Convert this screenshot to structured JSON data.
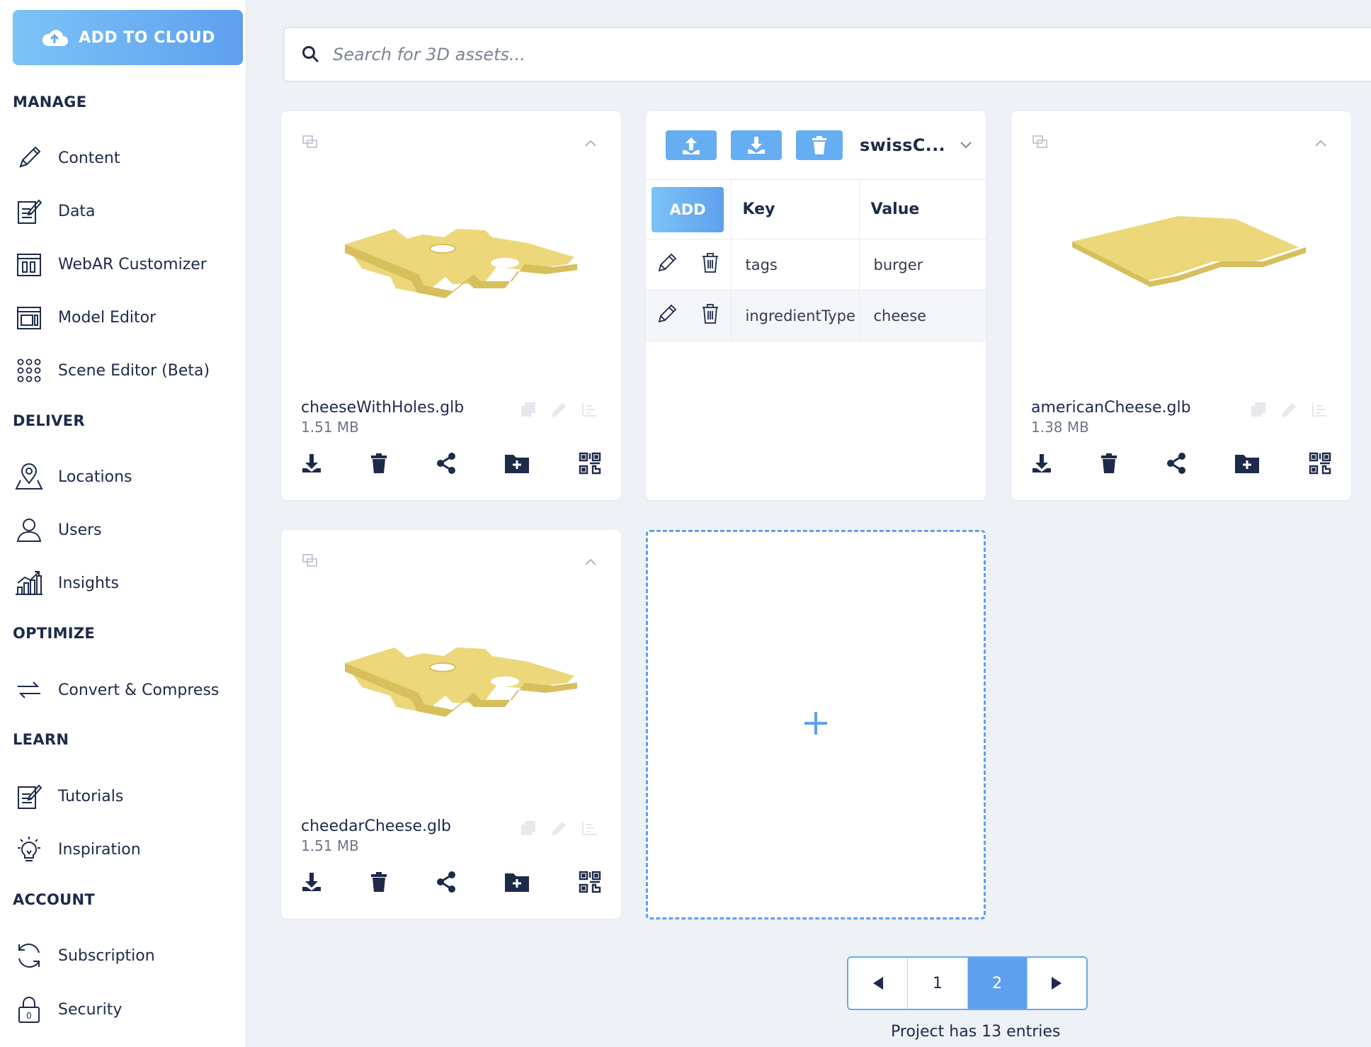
{
  "sidebar": {
    "cloud_button": "ADD TO CLOUD",
    "sections": {
      "manage": "MANAGE",
      "deliver": "DELIVER",
      "optimize": "OPTIMIZE",
      "learn": "LEARN",
      "account": "ACCOUNT"
    },
    "items": {
      "content": "Content",
      "data": "Data",
      "webar": "WebAR Customizer",
      "model_editor": "Model Editor",
      "scene_editor": "Scene Editor (Beta)",
      "locations": "Locations",
      "users": "Users",
      "insights": "Insights",
      "convert": "Convert & Compress",
      "tutorials": "Tutorials",
      "inspiration": "Inspiration",
      "subscription": "Subscription",
      "security": "Security"
    }
  },
  "search": {
    "placeholder": "Search for 3D assets..."
  },
  "cards": [
    {
      "name": "cheeseWithHoles.glb",
      "size": "1.51 MB"
    },
    {
      "name": "americanCheese.glb",
      "size": "1.38 MB"
    },
    {
      "name": "cheedarCheese.glb",
      "size": "1.51 MB"
    }
  ],
  "metadata": {
    "selected": "swissC...",
    "add_label": "ADD",
    "col_key": "Key",
    "col_value": "Value",
    "rows": [
      {
        "key": "tags",
        "value": "burger"
      },
      {
        "key": "ingredientType",
        "value": "cheese"
      }
    ]
  },
  "pagination": {
    "pages": [
      "1",
      "2"
    ],
    "current": "2",
    "summary": "Project has 13 entries"
  },
  "colors": {
    "accent": "#5fa0ee",
    "navy": "#1e2a4a",
    "cheese": "#ecd77a"
  }
}
